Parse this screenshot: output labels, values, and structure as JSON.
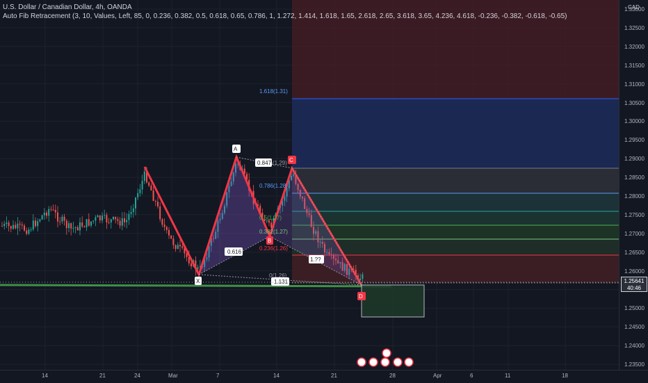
{
  "header": {
    "title": "U.S. Dollar / Canadian Dollar, 4h, OANDA",
    "indicator": "Auto Fib Retracement (3, 10, Values, Left, 85, 0, 0.236, 0.382, 0.5, 0.618, 0.65, 0.786, 1, 1.272, 1.414, 1.618, 1.65, 2.618, 2.65, 3.618, 3.65, 4.236, 4.618, -0.236, -0.382, -0.618, -0.65)"
  },
  "price_axis": {
    "currency": "CAD",
    "labels": [
      "1.33000",
      "1.32500",
      "1.32000",
      "1.31500",
      "1.31000",
      "1.30500",
      "1.30000",
      "1.29500",
      "1.29000",
      "1.28500",
      "1.28000",
      "1.27500",
      "1.27000",
      "1.26500",
      "1.26000",
      "1.25500",
      "1.25000",
      "1.24500",
      "1.24000",
      "1.23500"
    ],
    "current_price": "1.25641",
    "countdown": "40:46"
  },
  "time_axis": {
    "labels": [
      "14",
      "21",
      "24",
      "Mar",
      "7",
      "14",
      "21",
      "28",
      "Apr",
      "6",
      "11",
      "18"
    ]
  },
  "fib_labels": {
    "l1618": "1.618(1.31)",
    "l1": "0.847",
    "l1v": "(1.29)",
    "l0786": "0.786(1.28)",
    "l05": "0.5(1.27)",
    "l0382": "0.382(1.27)",
    "l0236": "0.236(1.26)",
    "l0": "0(1.26)"
  },
  "pattern_labels": {
    "x": "X",
    "a": "A",
    "b": "B",
    "c": "C",
    "d": "D",
    "r1": "0.616",
    "r2": "0.847",
    "r3": "1.131",
    "r4": "1.??"
  },
  "colors": {
    "background": "#131722",
    "up": "#26a69a",
    "down": "#ef5350",
    "pattern": "#f23645",
    "fib_blue": "#2962ff"
  }
}
